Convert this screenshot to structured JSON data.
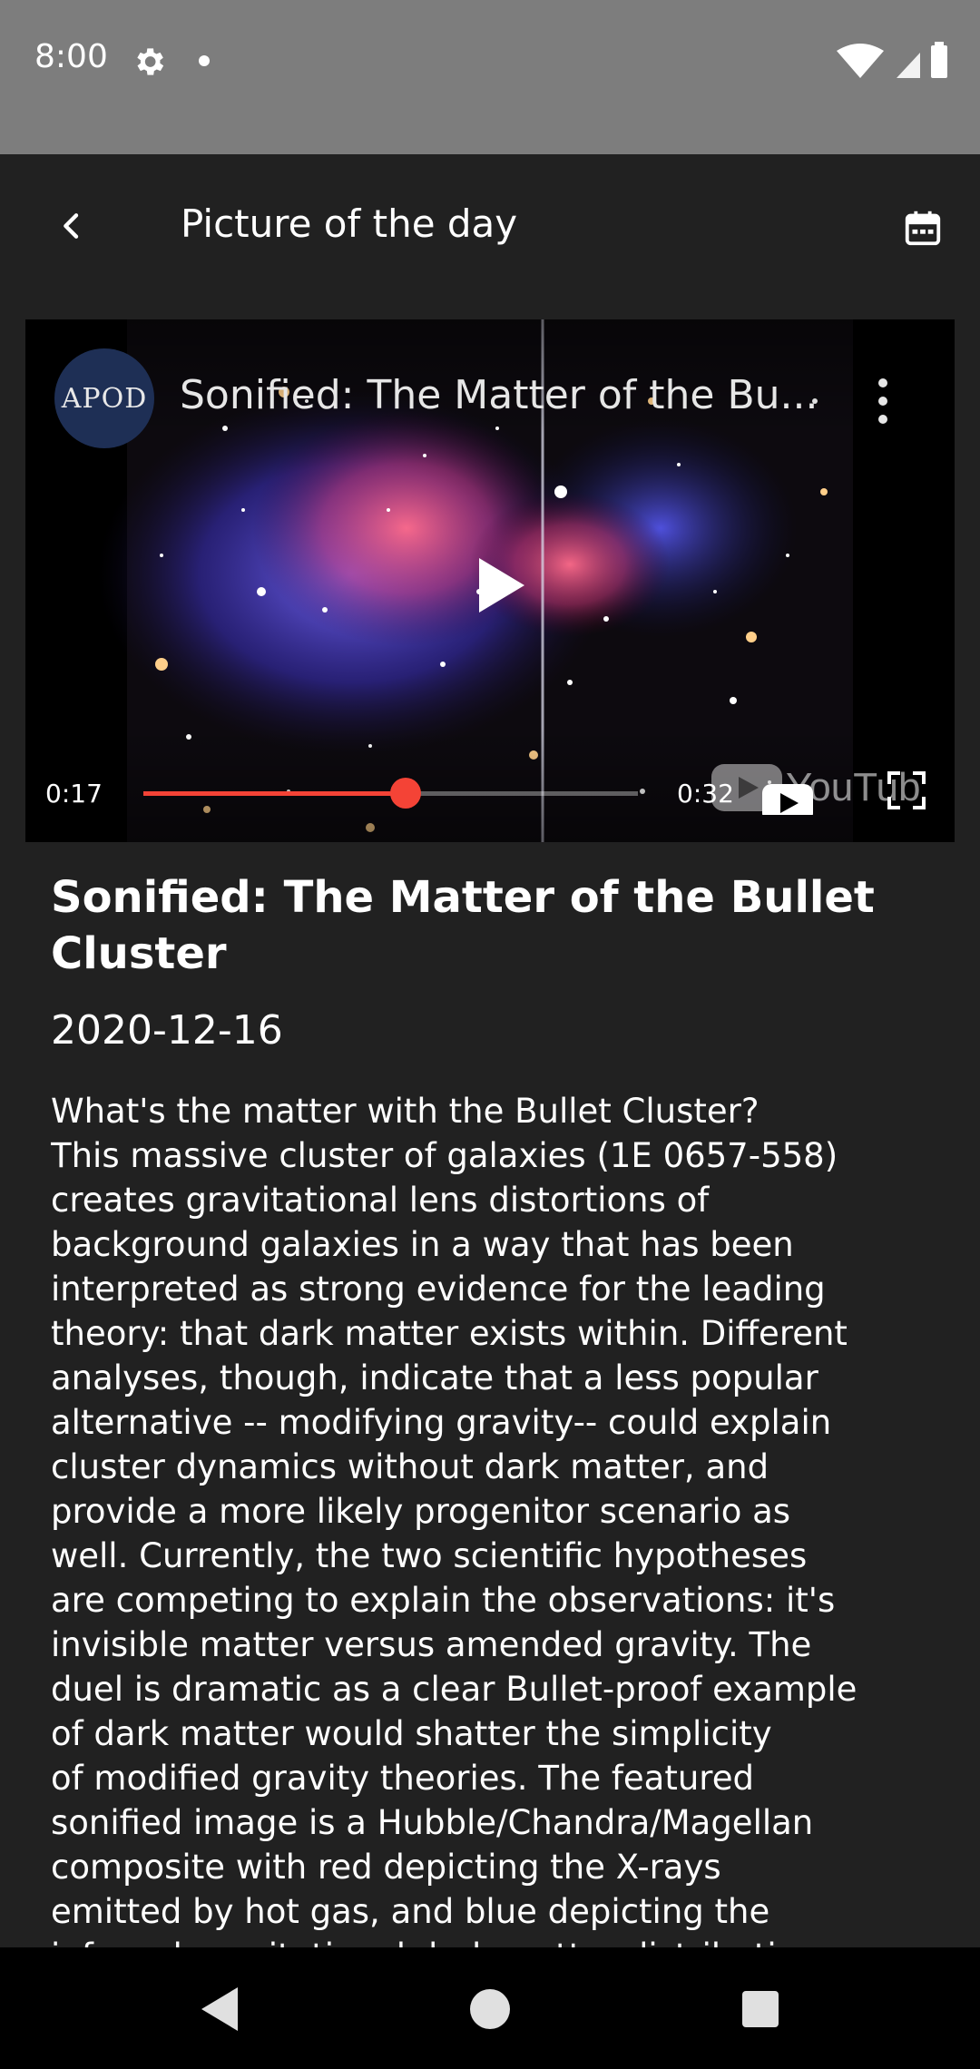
{
  "status_bar": {
    "time": "8:00"
  },
  "app_bar": {
    "title": "Picture of the day"
  },
  "video": {
    "channel_label": "APOD",
    "title": "Sonified: The Matter of the Bu...",
    "current_time": "0:17",
    "total_time": "0:32",
    "progress": 0.53,
    "logo_text": "YouTube",
    "accent_color": "#f44336"
  },
  "article": {
    "title": "Sonified: The Matter of the Bullet Cluster",
    "date": "2020-12-16",
    "body": "What's the matter with the Bullet Cluster?\nThis massive cluster of galaxies (1E 0657-558)\ncreates gravitational lens distortions of\nbackground galaxies in a way that has been\ninterpreted as strong evidence for the leading\ntheory: that dark matter exists within. Different\nanalyses, though, indicate that a less popular\nalternative -- modifying gravity-- could explain\ncluster dynamics without dark matter, and\nprovide a more likely progenitor scenario as\nwell. Currently, the two scientific hypotheses\nare competing to explain the observations: it's\ninvisible matter versus amended gravity. The\nduel is dramatic as a clear Bullet-proof example\nof dark matter would shatter the simplicity\nof modified gravity theories.  The featured\nsonified image is a Hubble/Chandra/Magellan\ncomposite with red depicting the X-rays\nemitted by hot gas, and blue depicting the\ninferred gravitational dark matter distribution."
  },
  "icons": {
    "status": [
      "gear-icon",
      "wifi-icon",
      "signal-icon",
      "battery-icon"
    ],
    "app_bar": [
      "back-arrow-icon",
      "calendar-icon"
    ],
    "video": [
      "more-vert-icon",
      "play-icon",
      "fullscreen-icon"
    ],
    "nav": [
      "nav-back-icon",
      "nav-home-icon",
      "nav-recents-icon"
    ]
  }
}
